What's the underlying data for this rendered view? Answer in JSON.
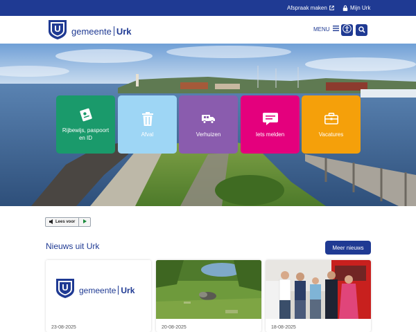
{
  "topbar": {
    "afspraak_label": "Afspraak maken",
    "mijn_urk_label": "Mijn Urk",
    "bg_color": "#1f3a93"
  },
  "header": {
    "logo_text_regular": "gemeente",
    "logo_text_bold": "Urk",
    "logo_shield_letter": "U",
    "menu_label": "MENU",
    "icons": [
      "menu-hamburger-icon",
      "accessibility-icon",
      "search-icon"
    ]
  },
  "hero": {
    "tiles": [
      {
        "label": "Rijbewijs, paspoort en ID",
        "icon": "id-card-icon",
        "color": "#1a9a6b"
      },
      {
        "label": "Afval",
        "icon": "trash-icon",
        "color": "#9ed6f5"
      },
      {
        "label": "Verhuizen",
        "icon": "moving-truck-icon",
        "color": "#8a5cae"
      },
      {
        "label": "Iets melden",
        "icon": "message-icon",
        "color": "#e4007d"
      },
      {
        "label": "Vacatures",
        "icon": "briefcase-icon",
        "color": "#f5a00a"
      }
    ]
  },
  "readspeaker": {
    "label": "Lees voor",
    "icons": [
      "speaker-icon",
      "play-icon"
    ]
  },
  "news": {
    "title": "Nieuws uit Urk",
    "more_label": "Meer nieuws",
    "items": [
      {
        "date": "23-08-2025",
        "image": "logo"
      },
      {
        "date": "20-08-2025",
        "image": "lakeside-grass"
      },
      {
        "date": "18-08-2025",
        "image": "group-photo-fire-station"
      }
    ]
  },
  "colors": {
    "brand_blue": "#1f3a93",
    "green": "#1a9a6b",
    "light_blue": "#9ed6f5",
    "purple": "#8a5cae",
    "pink": "#e4007d",
    "orange": "#f5a00a"
  }
}
